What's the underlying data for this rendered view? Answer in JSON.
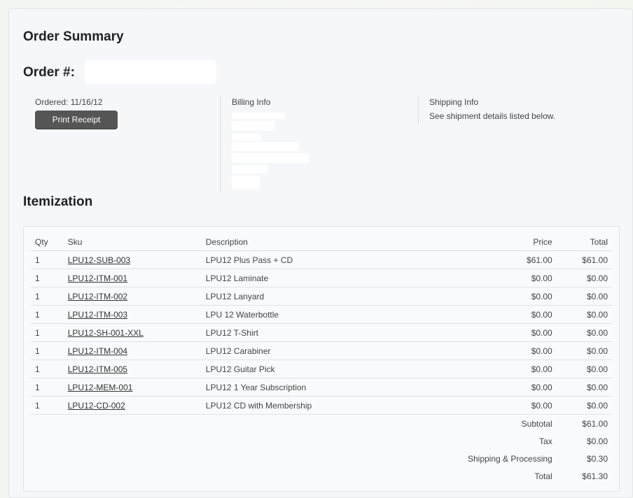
{
  "header": {
    "title": "Order Summary",
    "order_label": "Order #:"
  },
  "details": {
    "ordered": "Ordered: 11/16/12",
    "print_label": "Print Receipt",
    "billing_label": "Billing Info",
    "shipping_label": "Shipping Info",
    "shipping_note": "See shipment details listed below."
  },
  "itemization": {
    "title": "Itemization",
    "columns": {
      "qty": "Qty",
      "sku": "Sku",
      "description": "Description",
      "price": "Price",
      "total": "Total"
    },
    "rows": [
      {
        "qty": "1",
        "sku": "LPU12-SUB-003",
        "description": "LPU12 Plus Pass + CD",
        "price": "$61.00",
        "total": "$61.00"
      },
      {
        "qty": "1",
        "sku": "LPU12-ITM-001",
        "description": "LPU12 Laminate",
        "price": "$0.00",
        "total": "$0.00"
      },
      {
        "qty": "1",
        "sku": "LPU12-ITM-002",
        "description": "LPU12 Lanyard",
        "price": "$0.00",
        "total": "$0.00"
      },
      {
        "qty": "1",
        "sku": "LPU12-ITM-003",
        "description": "LPU 12 Waterbottle",
        "price": "$0.00",
        "total": "$0.00"
      },
      {
        "qty": "1",
        "sku": "LPU12-SH-001-XXL",
        "description": "LPU12 T-Shirt",
        "price": "$0.00",
        "total": "$0.00"
      },
      {
        "qty": "1",
        "sku": "LPU12-ITM-004",
        "description": "LPU12 Carabiner",
        "price": "$0.00",
        "total": "$0.00"
      },
      {
        "qty": "1",
        "sku": "LPU12-ITM-005",
        "description": "LPU12 Guitar Pick",
        "price": "$0.00",
        "total": "$0.00"
      },
      {
        "qty": "1",
        "sku": "LPU12-MEM-001",
        "description": "LPU12 1 Year Subscription",
        "price": "$0.00",
        "total": "$0.00"
      },
      {
        "qty": "1",
        "sku": "LPU12-CD-002",
        "description": "LPU12 CD with Membership",
        "price": "$0.00",
        "total": "$0.00"
      }
    ],
    "summary": [
      {
        "label": "Subtotal",
        "value": "$61.00"
      },
      {
        "label": "Tax",
        "value": "$0.00"
      },
      {
        "label": "Shipping & Processing",
        "value": "$0.30"
      },
      {
        "label": "Total",
        "value": "$61.30"
      }
    ]
  }
}
